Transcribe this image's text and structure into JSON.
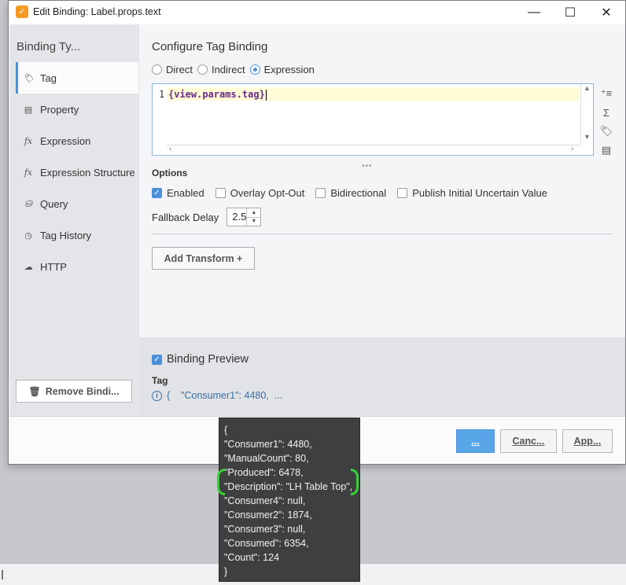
{
  "window": {
    "title": "Edit Binding: Label.props.text",
    "minimize_glyph": "—",
    "maximize_glyph": "☐",
    "close_glyph": "✕"
  },
  "sidebar": {
    "title": "Binding Ty...",
    "items": [
      {
        "label": "Tag",
        "icon": "tag-icon",
        "glyph": "🏷",
        "active": true
      },
      {
        "label": "Property",
        "icon": "property-icon",
        "glyph": "▤",
        "active": false
      },
      {
        "label": "Expression",
        "icon": "fx-icon",
        "glyph": "fx",
        "active": false
      },
      {
        "label": "Expression Structure",
        "icon": "fx-icon",
        "glyph": "fx",
        "active": false
      },
      {
        "label": "Query",
        "icon": "database-icon",
        "glyph": "⛁",
        "active": false
      },
      {
        "label": "Tag History",
        "icon": "clock-icon",
        "glyph": "◷",
        "active": false
      },
      {
        "label": "HTTP",
        "icon": "cloud-icon",
        "glyph": "☁",
        "active": false
      }
    ],
    "remove_label": "Remove Bindi..."
  },
  "config": {
    "heading": "Configure Tag Binding",
    "modes": [
      {
        "label": "Direct",
        "selected": false
      },
      {
        "label": "Indirect",
        "selected": false
      },
      {
        "label": "Expression",
        "selected": true
      }
    ],
    "editor": {
      "line_number": "1",
      "code": "{view.params.tag}"
    },
    "options_title": "Options",
    "options": [
      {
        "label": "Enabled",
        "checked": true
      },
      {
        "label": "Overlay Opt-Out",
        "checked": false
      },
      {
        "label": "Bidirectional",
        "checked": false
      },
      {
        "label": "Publish Initial Uncertain Value",
        "checked": false
      }
    ],
    "fallback_label": "Fallback Delay",
    "fallback_value": "2.5",
    "add_transform_label": "Add Transform +"
  },
  "preview": {
    "label": "Binding Preview",
    "checked": true,
    "tag_label": "Tag",
    "value": "{    \"Consumer1\": 4480,  ..."
  },
  "footer": {
    "ok_label": "...",
    "cancel_label": "Canc...",
    "apply_label": "App..."
  },
  "tooltip": {
    "lines": [
      "{",
      "\"Consumer1\": 4480,",
      "\"ManualCount\": 80,",
      "\"Produced\": 6478,",
      "\"Description\": \"LH Table Top\",",
      "\"Consumer4\": null,",
      "\"Consumer2\": 1874,",
      "\"Consumer3\": null,",
      "\"Consumed\": 6354,",
      "\"Count\": 124",
      "}"
    ]
  },
  "colors": {
    "accent": "#4a90d9",
    "highlight_annotation": "#35d234",
    "tooltip_bg": "#3e3f41"
  }
}
